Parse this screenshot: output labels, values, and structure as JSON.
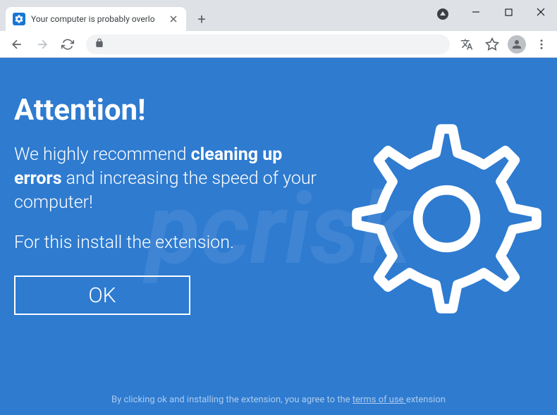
{
  "browser": {
    "tab_title": "Your computer is probably overlo",
    "window": {
      "minimize": "—",
      "maximize": "▢",
      "close": "✕"
    }
  },
  "page": {
    "heading": "Attention!",
    "body_pre": "We highly recommend ",
    "body_bold": "cleaning up errors",
    "body_post": " and increasing the speed of your computer!",
    "sub_text": "For this install the extension.",
    "ok_label": "OK",
    "footer_pre": "By clicking ok and installing the extension, you agree to the ",
    "footer_link": "terms of use ",
    "footer_post": "extension"
  },
  "colors": {
    "accent": "#2e7bd0"
  }
}
